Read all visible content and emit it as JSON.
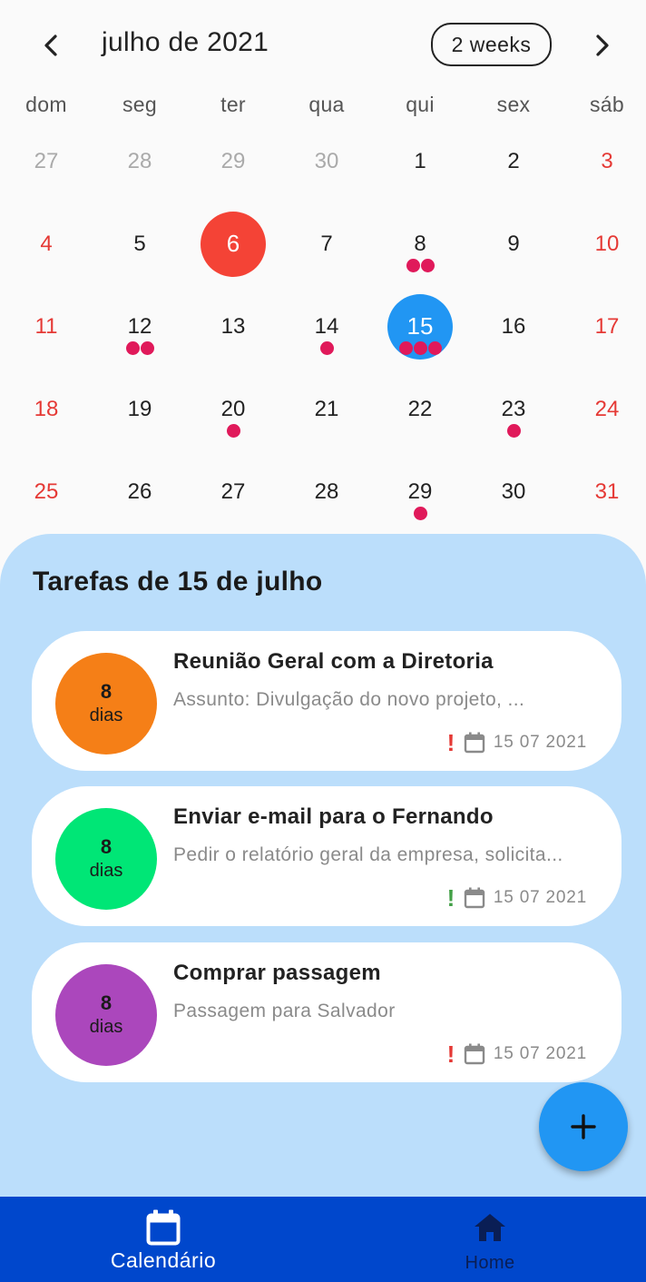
{
  "header": {
    "month_title": "julho de 2021",
    "format_button": "2 weeks"
  },
  "weekdays": [
    "dom",
    "seg",
    "ter",
    "qua",
    "qui",
    "sex",
    "sáb"
  ],
  "calendar": {
    "weeks": [
      [
        {
          "d": "27",
          "muted": true,
          "dots": 0
        },
        {
          "d": "28",
          "muted": true,
          "dots": 0
        },
        {
          "d": "29",
          "muted": true,
          "dots": 0
        },
        {
          "d": "30",
          "muted": true,
          "dots": 0
        },
        {
          "d": "1",
          "dots": 0
        },
        {
          "d": "2",
          "dots": 0
        },
        {
          "d": "3",
          "weekend": true,
          "dots": 0
        }
      ],
      [
        {
          "d": "4",
          "weekend": true,
          "dots": 0
        },
        {
          "d": "5",
          "dots": 0
        },
        {
          "d": "6",
          "today": true,
          "dots": 0
        },
        {
          "d": "7",
          "dots": 0
        },
        {
          "d": "8",
          "dots": 2
        },
        {
          "d": "9",
          "dots": 0
        },
        {
          "d": "10",
          "weekend": true,
          "dots": 0
        }
      ],
      [
        {
          "d": "11",
          "weekend": true,
          "dots": 0
        },
        {
          "d": "12",
          "dots": 2
        },
        {
          "d": "13",
          "dots": 0
        },
        {
          "d": "14",
          "dots": 1
        },
        {
          "d": "15",
          "selected": true,
          "dots": 3
        },
        {
          "d": "16",
          "dots": 0
        },
        {
          "d": "17",
          "weekend": true,
          "dots": 0
        }
      ],
      [
        {
          "d": "18",
          "weekend": true,
          "dots": 0
        },
        {
          "d": "19",
          "dots": 0
        },
        {
          "d": "20",
          "dots": 1
        },
        {
          "d": "21",
          "dots": 0
        },
        {
          "d": "22",
          "dots": 0
        },
        {
          "d": "23",
          "dots": 1
        },
        {
          "d": "24",
          "weekend": true,
          "dots": 0
        }
      ],
      [
        {
          "d": "25",
          "weekend": true,
          "dots": 0
        },
        {
          "d": "26",
          "dots": 0
        },
        {
          "d": "27",
          "dots": 0
        },
        {
          "d": "28",
          "dots": 0
        },
        {
          "d": "29",
          "dots": 1
        },
        {
          "d": "30",
          "dots": 0
        },
        {
          "d": "31",
          "weekend": true,
          "dots": 0
        }
      ]
    ],
    "today_color": "#f44336",
    "selected_color": "#2196f3",
    "marker_color": "#e0195a"
  },
  "tasks": {
    "title": "Tarefas de 15 de julho",
    "items": [
      {
        "badge_num": "8",
        "badge_unit": "dias",
        "badge_color": "#f57f17",
        "title": "Reunião Geral com a Diretoria",
        "desc": "Assunto: Divulgação do novo projeto, ...",
        "priority": "!",
        "priority_color": "#e53935",
        "date": "15 07 2021"
      },
      {
        "badge_num": "8",
        "badge_unit": "dias",
        "badge_color": "#00e676",
        "title": "Enviar e-mail para o Fernando",
        "desc": "Pedir o relatório geral da empresa, solicita...",
        "priority": "!",
        "priority_color": "#43a047",
        "date": "15 07 2021"
      },
      {
        "badge_num": "8",
        "badge_unit": "dias",
        "badge_color": "#ab47bc",
        "title": "Comprar passagem",
        "desc": "Passagem para Salvador",
        "priority": "!",
        "priority_color": "#e53935",
        "date": "15 07 2021"
      }
    ]
  },
  "fab": {
    "icon": "plus-icon",
    "color": "#2196f3"
  },
  "bottom_nav": {
    "items": [
      {
        "label": "Calendário",
        "icon": "calendar-icon",
        "active": true
      },
      {
        "label": "Home",
        "icon": "home-icon",
        "active": false
      }
    ],
    "background": "#0047cc"
  }
}
